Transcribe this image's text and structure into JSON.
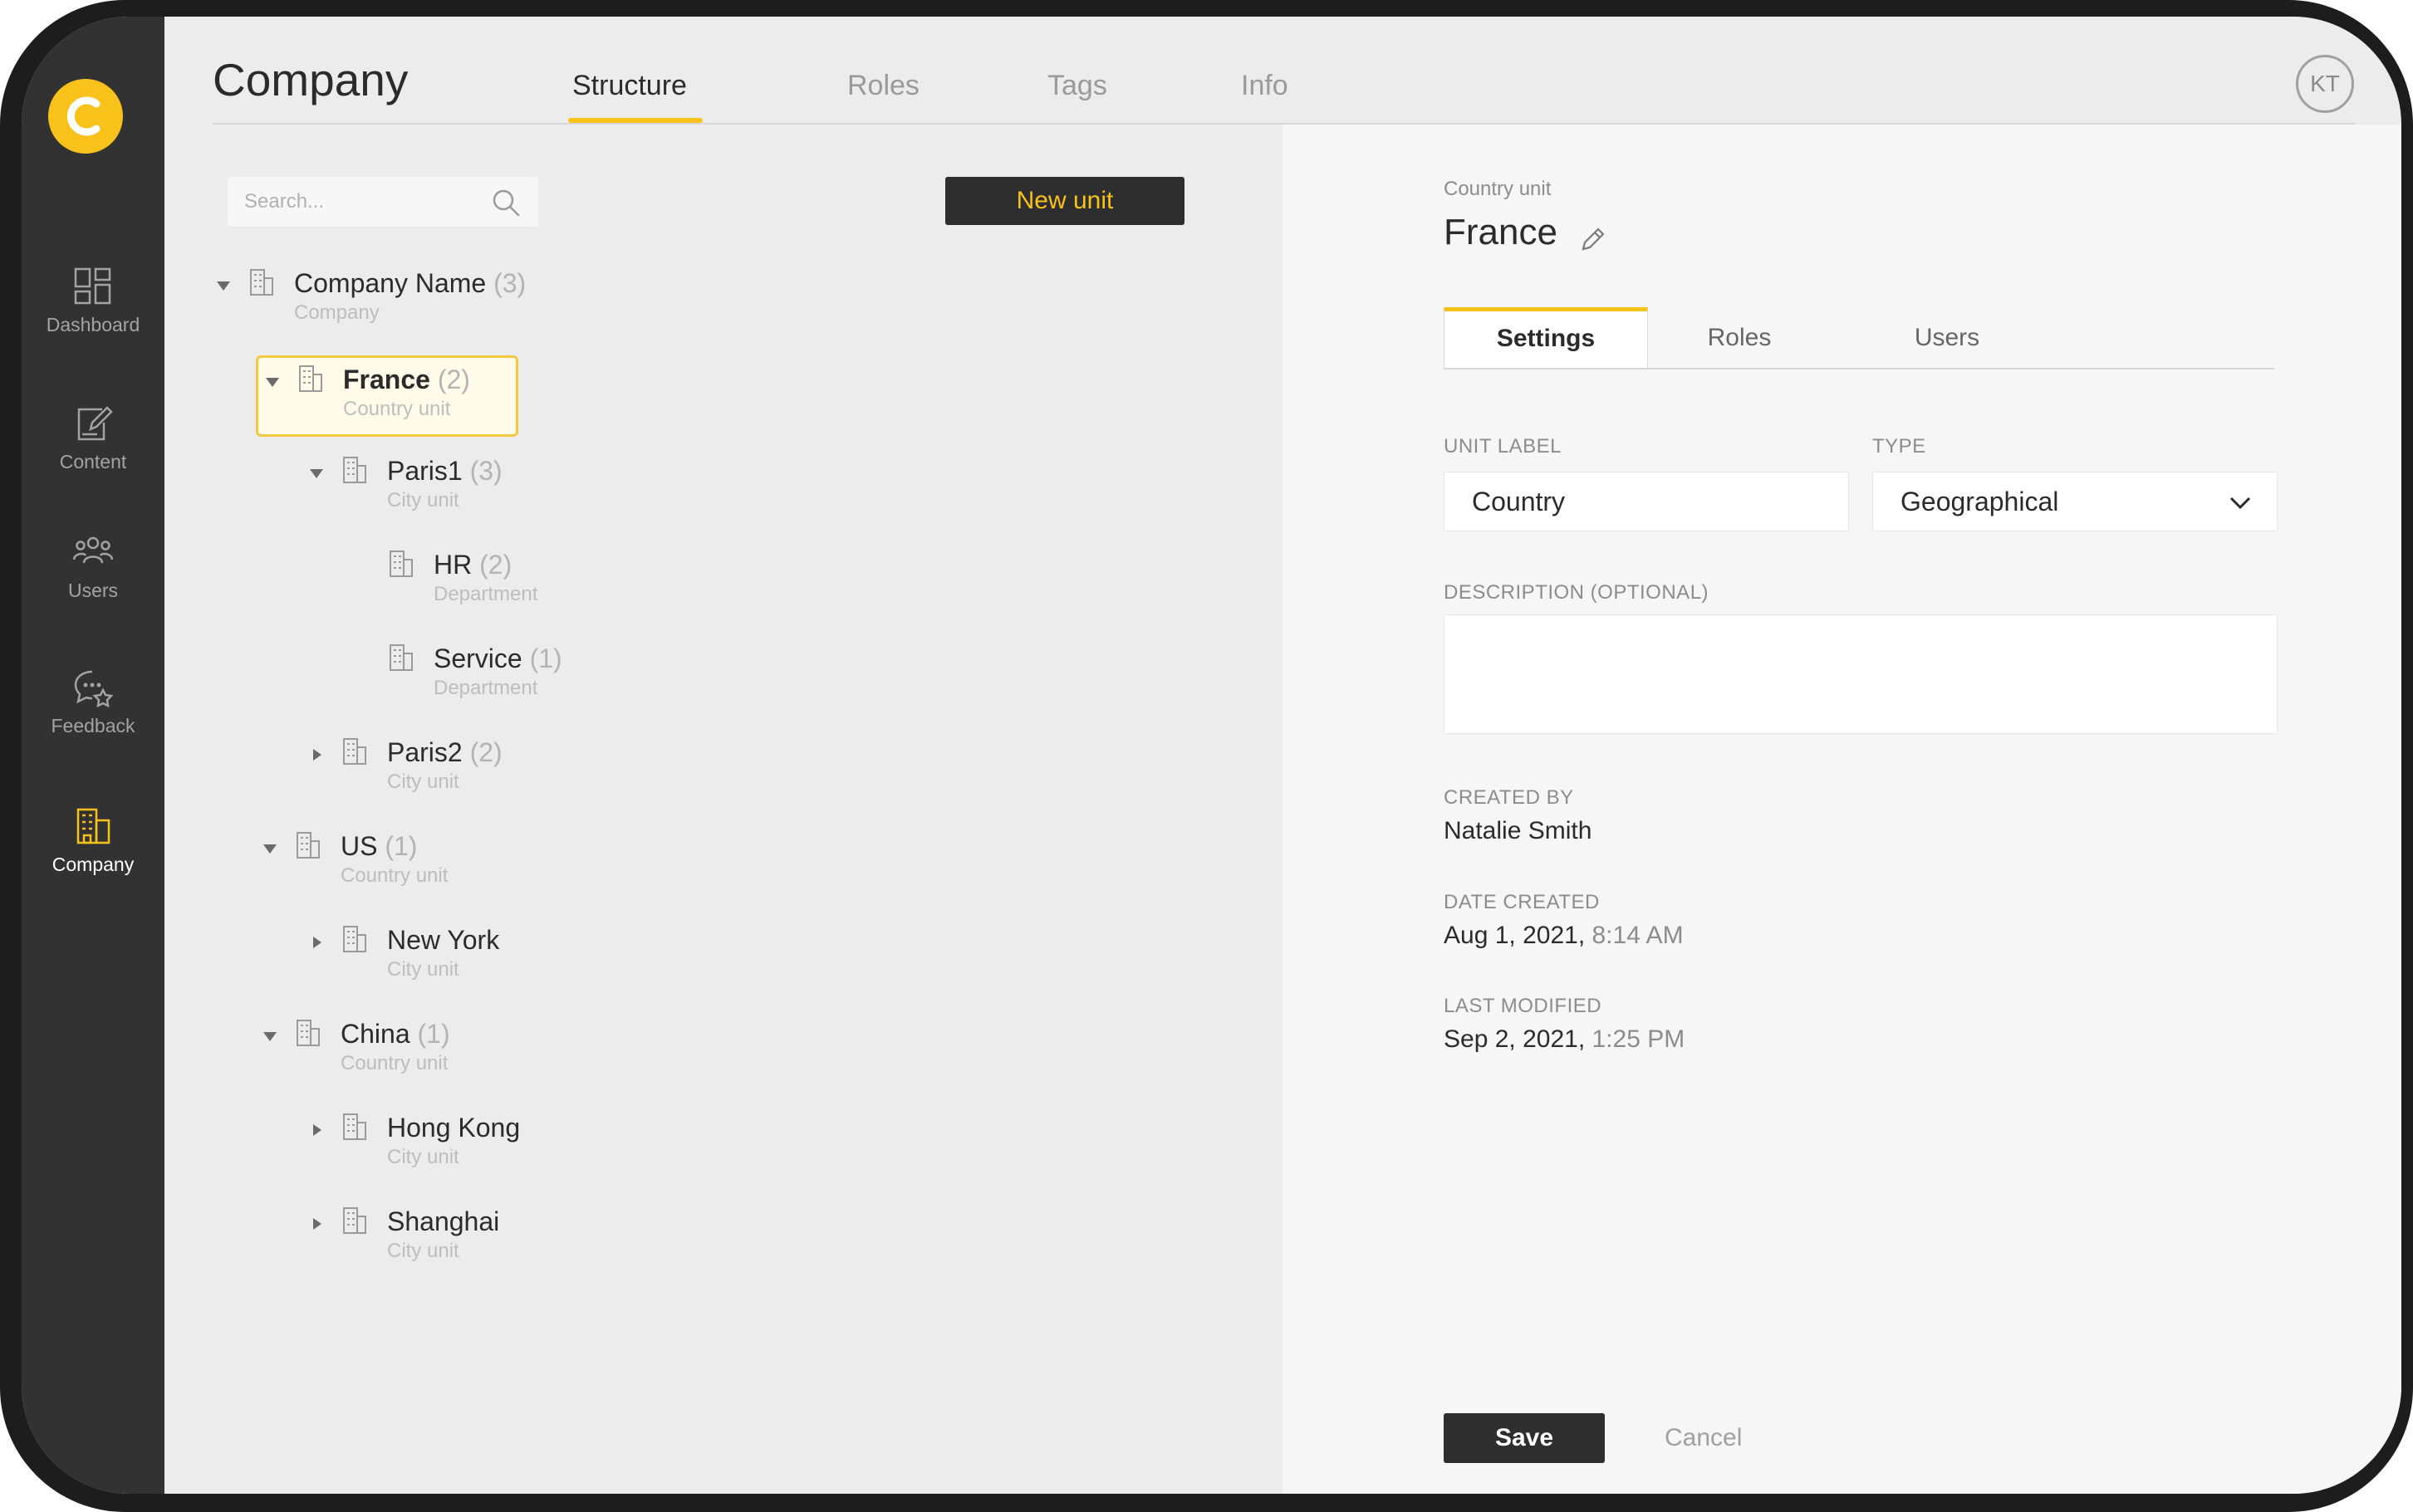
{
  "app": {
    "title": "Company",
    "user_initials": "KT",
    "brand_color": "#f9c21a"
  },
  "tabs": [
    {
      "label": "Structure",
      "active": true
    },
    {
      "label": "Roles",
      "active": false
    },
    {
      "label": "Tags",
      "active": false
    },
    {
      "label": "Info",
      "active": false
    }
  ],
  "sidebar": {
    "items": [
      {
        "label": "Dashboard",
        "icon": "dashboard-icon",
        "active": false
      },
      {
        "label": "Content",
        "icon": "content-edit-icon",
        "active": false
      },
      {
        "label": "Users",
        "icon": "users-icon",
        "active": false
      },
      {
        "label": "Feedback",
        "icon": "feedback-icon",
        "active": false
      },
      {
        "label": "Company",
        "icon": "building-icon",
        "active": true
      }
    ]
  },
  "left_panel": {
    "search_placeholder": "Search...",
    "new_unit_label": "New unit",
    "tree": [
      {
        "name": "Company Name",
        "count": "(3)",
        "type": "Company",
        "caret": "expanded",
        "selected": false
      },
      {
        "name": "France",
        "count": "(2)",
        "type": "Country unit",
        "caret": "expanded",
        "selected": true
      },
      {
        "name": "Paris1",
        "count": "(3)",
        "type": "City unit",
        "caret": "expanded",
        "selected": false
      },
      {
        "name": "HR",
        "count": "(2)",
        "type": "Department",
        "caret": "none",
        "selected": false
      },
      {
        "name": "Service",
        "count": "(1)",
        "type": "Department",
        "caret": "none",
        "selected": false
      },
      {
        "name": "Paris2",
        "count": "(2)",
        "type": "City unit",
        "caret": "collapsed",
        "selected": false
      },
      {
        "name": "US",
        "count": "(1)",
        "type": "Country unit",
        "caret": "expanded",
        "selected": false
      },
      {
        "name": "New York",
        "count": "",
        "type": "City unit",
        "caret": "collapsed",
        "selected": false
      },
      {
        "name": "China",
        "count": "(1)",
        "type": "Country unit",
        "caret": "expanded",
        "selected": false
      },
      {
        "name": "Hong Kong",
        "count": "",
        "type": "City unit",
        "caret": "collapsed",
        "selected": false
      },
      {
        "name": "Shanghai",
        "count": "",
        "type": "City unit",
        "caret": "collapsed",
        "selected": false
      }
    ]
  },
  "detail": {
    "kind": "Country unit",
    "title": "France",
    "subtabs": [
      {
        "label": "Settings",
        "active": true
      },
      {
        "label": "Roles",
        "active": false
      },
      {
        "label": "Users",
        "active": false
      }
    ],
    "unit_label": {
      "label": "UNIT LABEL",
      "value": "Country"
    },
    "type": {
      "label": "TYPE",
      "value": "Geographical"
    },
    "description": {
      "label": "DESCRIPTION (OPTIONAL)",
      "value": ""
    },
    "created_by": {
      "label": "CREATED BY",
      "value": "Natalie Smith"
    },
    "date_created": {
      "label": "DATE CREATED",
      "date": "Aug 1, 2021",
      "time": "8:14 AM"
    },
    "last_modified": {
      "label": "LAST MODIFIED",
      "date": "Sep 2, 2021",
      "time": "1:25 PM"
    },
    "save_label": "Save",
    "cancel_label": "Cancel"
  }
}
